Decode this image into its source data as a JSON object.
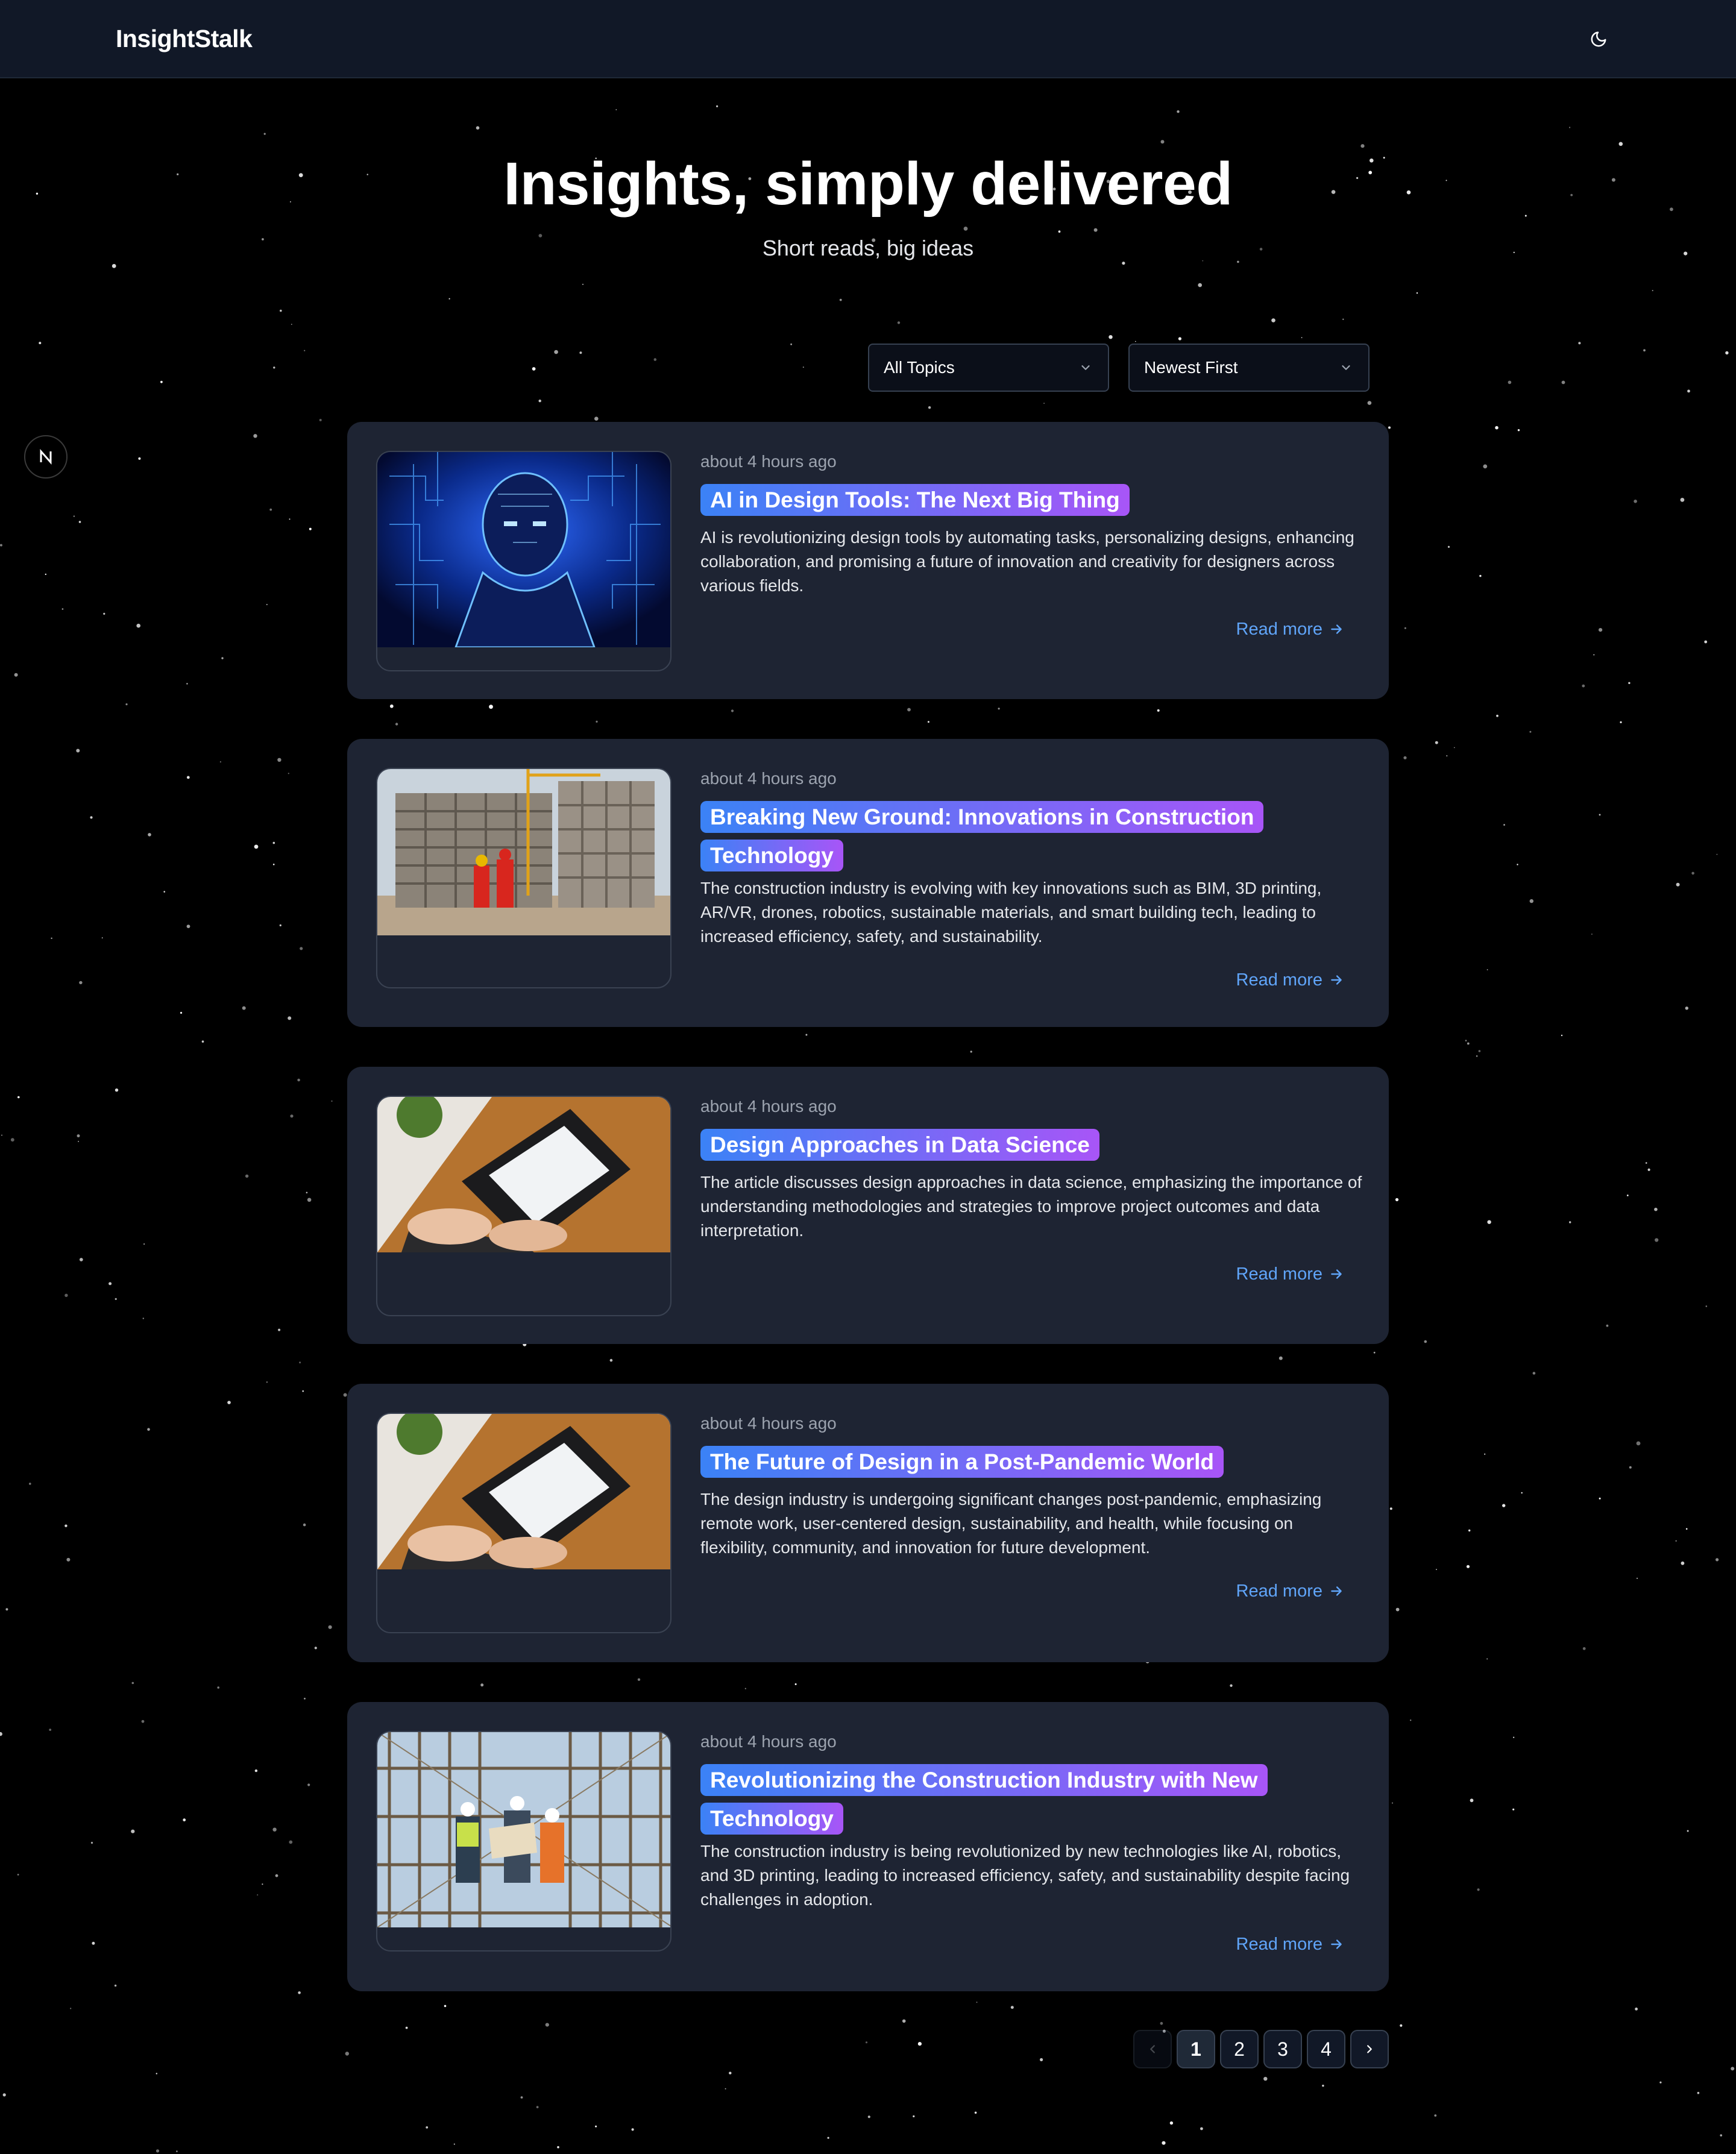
{
  "app": {
    "brand": "InsightStalk"
  },
  "hero": {
    "title": "Insights, simply delivered",
    "subtitle": "Short reads, big ideas"
  },
  "filters": {
    "topic": "All Topics",
    "sort": "Newest First"
  },
  "posts": [
    {
      "time": "about 4 hours ago",
      "title": "AI in Design Tools: The Next Big Thing",
      "excerpt": "AI is revolutionizing design tools by automating tasks, personalizing designs, enhancing collaboration, and promising a future of innovation and creativity for designers across various fields.",
      "read_more": "Read more",
      "image": "ai-robot-head-image"
    },
    {
      "time": "about 4 hours ago",
      "title": "Breaking New Ground: Innovations in Construction Technology",
      "excerpt": "The construction industry is evolving with key innovations such as BIM, 3D printing, AR/VR, drones, robotics, sustainable materials, and smart building tech, leading to increased efficiency, safety, and sustainability.",
      "read_more": "Read more",
      "image": "construction-site-image"
    },
    {
      "time": "about 4 hours ago",
      "title": "Design Approaches in Data Science",
      "excerpt": "The article discusses design approaches in data science, emphasizing the importance of understanding methodologies and strategies to improve project outcomes and data interpretation.",
      "read_more": "Read more",
      "image": "laptop-desk-image"
    },
    {
      "time": "about 4 hours ago",
      "title": "The Future of Design in a Post-Pandemic World",
      "excerpt": "The design industry is undergoing significant changes post-pandemic, emphasizing remote work, user-centered design, sustainability, and health, while focusing on flexibility, community, and innovation for future development.",
      "read_more": "Read more",
      "image": "laptop-desk-image"
    },
    {
      "time": "about 4 hours ago",
      "title": "Revolutionizing the Construction Industry with New Technology",
      "excerpt": "The construction industry is being revolutionized by new technologies like AI, robotics, and 3D printing, leading to increased efficiency, safety, and sustainability despite facing challenges in adoption.",
      "read_more": "Read more",
      "image": "scaffolding-workers-image"
    }
  ],
  "pagination": {
    "pages": [
      "1",
      "2",
      "3",
      "4"
    ],
    "current": "1"
  },
  "colors": {
    "accent_start": "#3b82f6",
    "accent_end": "#a855f7",
    "link": "#60a5fa",
    "card": "#1e2433",
    "nav": "#111827"
  },
  "icons": {
    "theme": "moon-icon",
    "dropdown": "chevron-down-icon",
    "read_more": "arrow-right-icon",
    "prev": "chevron-left-icon",
    "next": "chevron-right-icon",
    "badge": "nextjs-logo-icon"
  }
}
